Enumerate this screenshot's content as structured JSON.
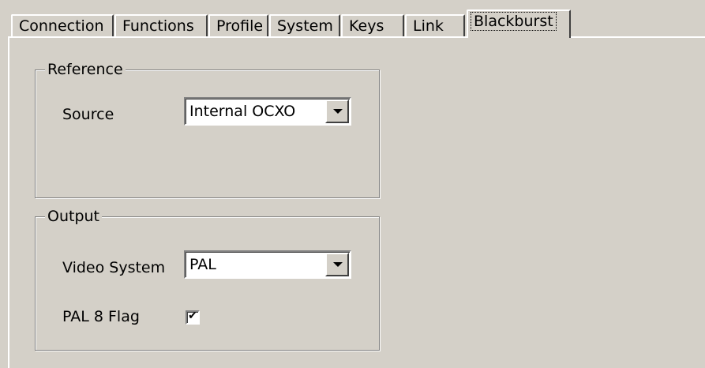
{
  "tabs": [
    {
      "label": "Connection",
      "active": false
    },
    {
      "label": "Functions",
      "active": false
    },
    {
      "label": "Profile",
      "active": false
    },
    {
      "label": "System",
      "active": false
    },
    {
      "label": "Keys",
      "active": false
    },
    {
      "label": "Link",
      "active": false
    },
    {
      "label": "Blackburst",
      "active": true
    }
  ],
  "reference": {
    "title": "Reference",
    "source_label": "Source",
    "source_value": "Internal OCXO"
  },
  "output": {
    "title": "Output",
    "video_system_label": "Video System",
    "video_system_value": "PAL",
    "pal8_label": "PAL 8 Flag",
    "pal8_checked": true
  },
  "icons": {
    "dropdown": "chevron-down-icon",
    "check": "checkmark-icon"
  },
  "colors": {
    "face": "#d4d0c8",
    "highlight": "#ffffff",
    "shadow": "#808080",
    "dark_shadow": "#404040",
    "field": "#ffffff"
  }
}
